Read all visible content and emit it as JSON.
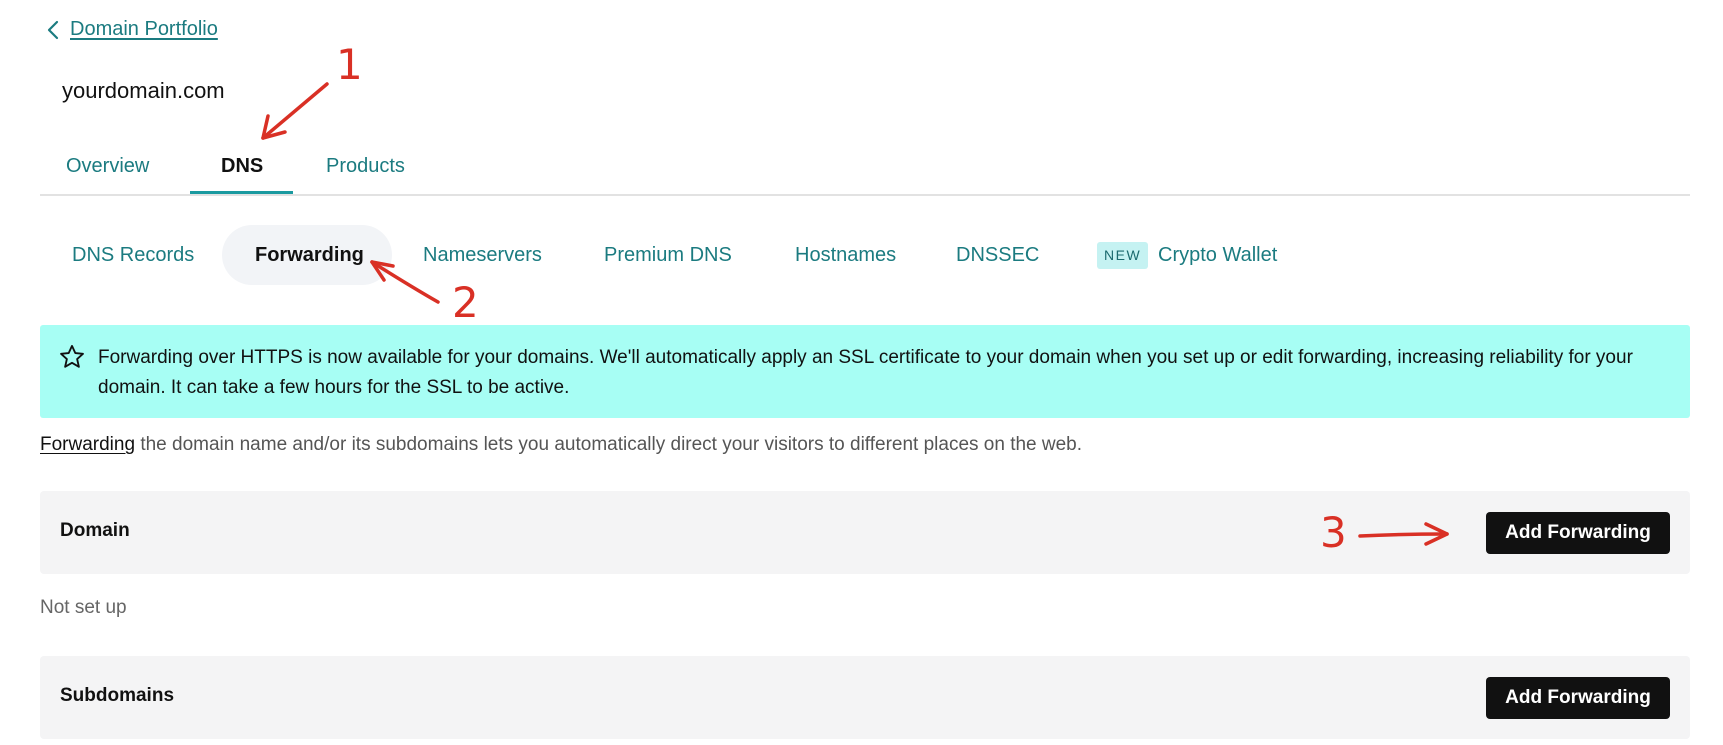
{
  "breadcrumb": {
    "back_label": "Domain Portfolio"
  },
  "domain": {
    "name": "yourdomain.com"
  },
  "main_tabs": [
    {
      "label": "Overview",
      "active": false
    },
    {
      "label": "DNS",
      "active": true
    },
    {
      "label": "Products",
      "active": false
    }
  ],
  "sub_tabs": [
    {
      "label": "DNS Records",
      "active": false
    },
    {
      "label": "Forwarding",
      "active": true
    },
    {
      "label": "Nameservers",
      "active": false
    },
    {
      "label": "Premium DNS",
      "active": false
    },
    {
      "label": "Hostnames",
      "active": false
    },
    {
      "label": "DNSSEC",
      "active": false
    },
    {
      "label": "Crypto Wallet",
      "active": false,
      "badge": "NEW"
    }
  ],
  "banner": {
    "icon": "star-icon",
    "text": "Forwarding over HTTPS is now available for your domains. We'll automatically apply an SSL certificate to your domain when you set up or edit forwarding, increasing reliability for your domain. It can take a few hours for the SSL to be active."
  },
  "intro": {
    "link_text": "Forwarding",
    "text": " the domain name and/or its subdomains lets you automatically direct your visitors to different places on the web."
  },
  "domain_section": {
    "title": "Domain",
    "button_label": "Add Forwarding",
    "status": "Not set up"
  },
  "subdomains_section": {
    "title": "Subdomains",
    "button_label": "Add Forwarding"
  },
  "annotations": [
    "1",
    "2",
    "3"
  ],
  "colors": {
    "accent": "#1b7b80",
    "banner_bg": "#a7fef4",
    "annotation": "#d93025",
    "button_bg": "#111111"
  }
}
